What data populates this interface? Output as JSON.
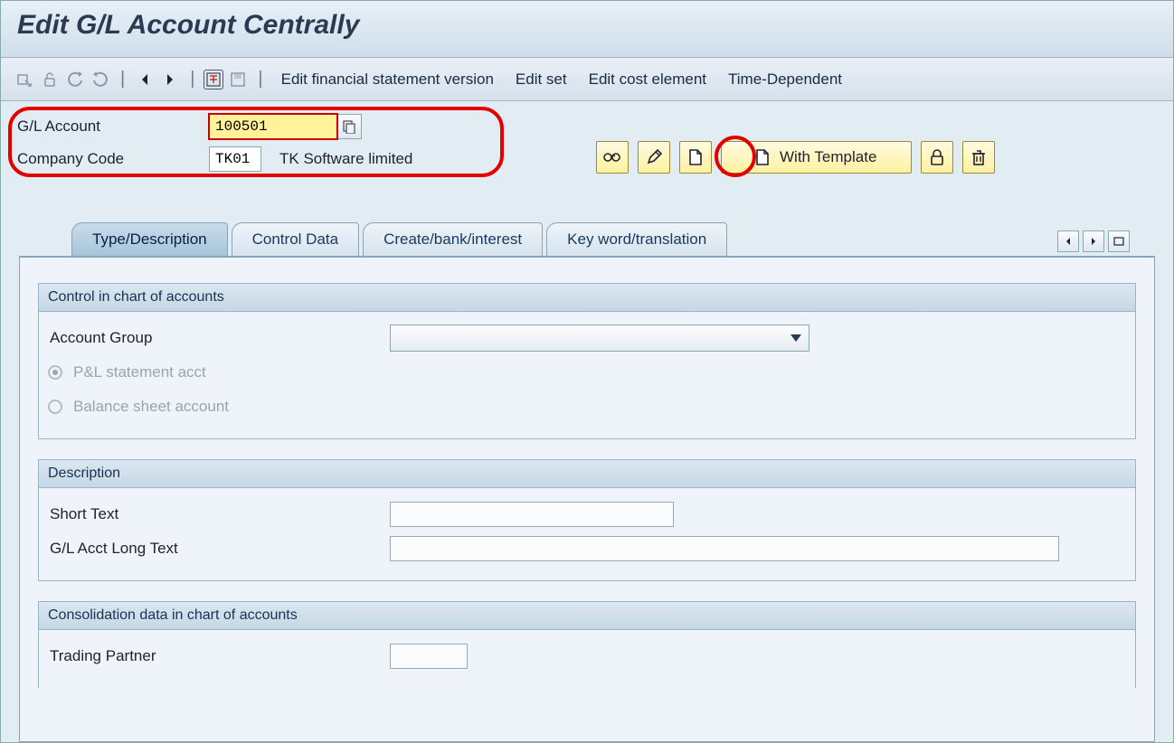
{
  "title": "Edit G/L Account Centrally",
  "toolbar": {
    "text_items": [
      "Edit financial statement version",
      "Edit set",
      "Edit cost element",
      "Time-Dependent"
    ]
  },
  "header": {
    "gl_label": "G/L Account",
    "gl_value": "100501",
    "cc_label": "Company Code",
    "cc_value": "TK01",
    "cc_name": "TK Software limited"
  },
  "actions": {
    "with_template": "With Template"
  },
  "tabs": [
    "Type/Description",
    "Control Data",
    "Create/bank/interest",
    "Key word/translation"
  ],
  "groups": {
    "control": {
      "title": "Control in chart of accounts",
      "account_group_label": "Account Group",
      "pl_label": "P&L statement acct",
      "bs_label": "Balance sheet account"
    },
    "description": {
      "title": "Description",
      "short_label": "Short Text",
      "long_label": "G/L Acct Long Text",
      "short_value": "",
      "long_value": ""
    },
    "consolidation": {
      "title": "Consolidation data in chart of accounts",
      "trading_partner_label": "Trading Partner",
      "trading_partner_value": ""
    }
  }
}
